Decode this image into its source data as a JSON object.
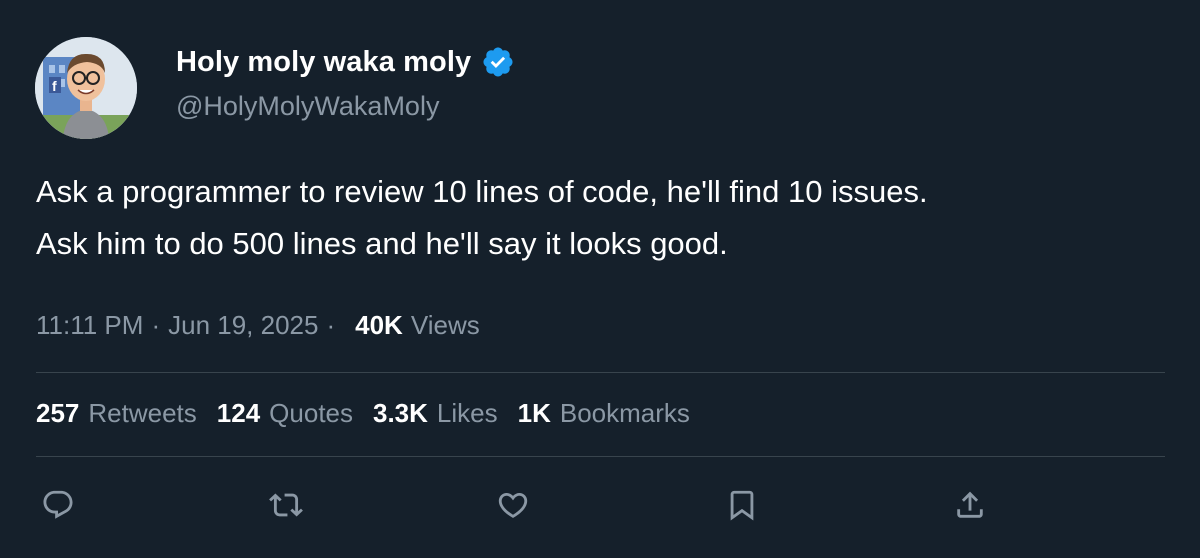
{
  "author": {
    "display_name": "Holy moly waka moly",
    "handle": "@HolyMolyWakaMoly",
    "verified": true,
    "verified_color": "#1d9bf0"
  },
  "tweet": {
    "line1": "Ask a programmer to review 10 lines of code, he'll find 10 issues.",
    "line2": "Ask him to do 500 lines and he'll say it looks good."
  },
  "meta": {
    "time": "11:11 PM",
    "separator": "·",
    "date": "Jun 19, 2025",
    "views_count": "40K",
    "views_label": "Views"
  },
  "stats": {
    "retweets": {
      "count": "257",
      "label": "Retweets"
    },
    "quotes": {
      "count": "124",
      "label": "Quotes"
    },
    "likes": {
      "count": "3.3K",
      "label": "Likes"
    },
    "bookmarks": {
      "count": "1K",
      "label": "Bookmarks"
    }
  },
  "actions": [
    "reply-icon",
    "retweet-icon",
    "like-icon",
    "bookmark-icon",
    "share-icon"
  ],
  "colors": {
    "background": "#15202b",
    "text": "#ffffff",
    "secondary_text": "#8b98a5",
    "divider": "#38444d"
  }
}
